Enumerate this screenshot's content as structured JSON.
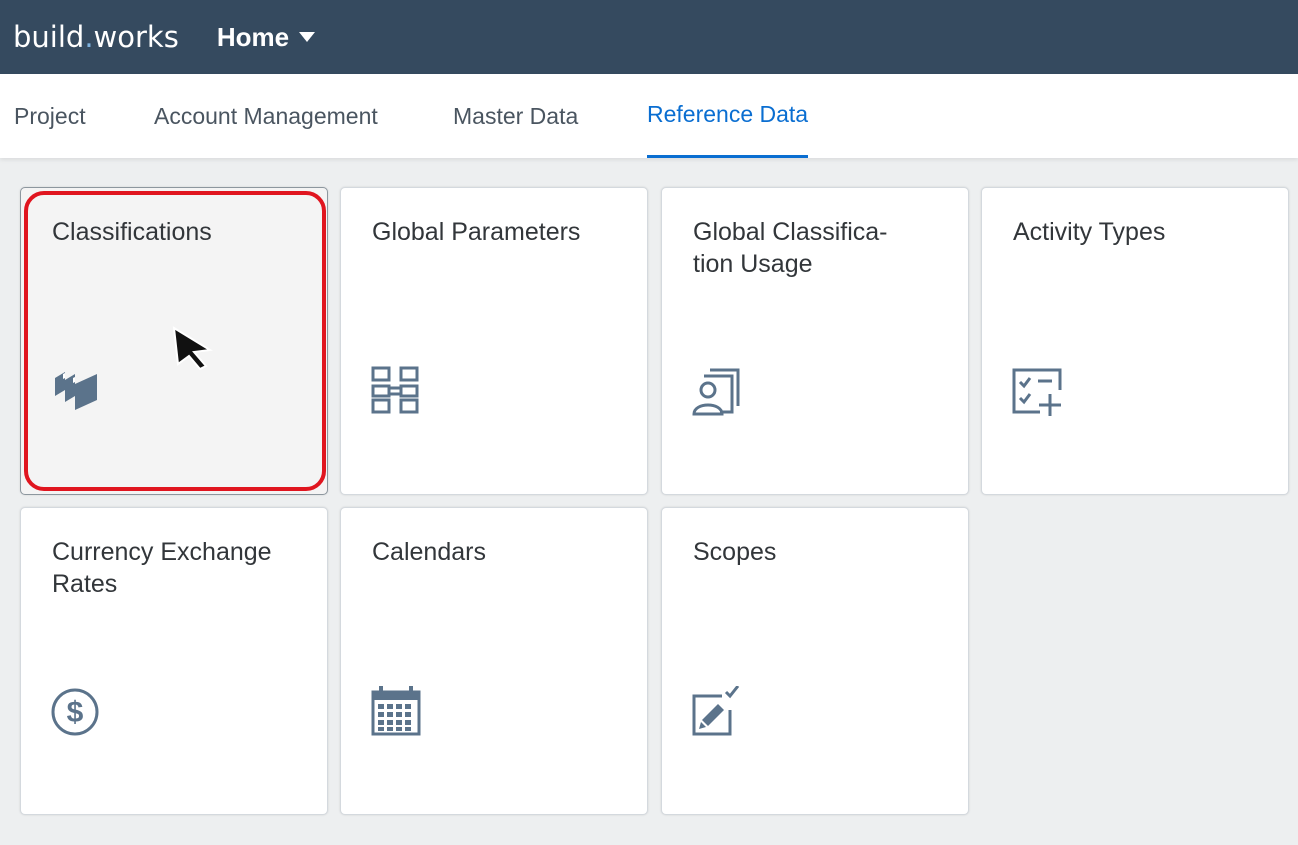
{
  "app": {
    "logo_part1": "build",
    "logo_dot": ".",
    "logo_part2": "works",
    "menu_label": "Home"
  },
  "tabs": [
    {
      "label": "Project",
      "active": false
    },
    {
      "label": "Account Management",
      "active": false
    },
    {
      "label": "Master Data",
      "active": false
    },
    {
      "label": "Reference Data",
      "active": true
    }
  ],
  "tiles": [
    {
      "title": "Classifications",
      "icon": "layers-icon"
    },
    {
      "title": "Global Parameters",
      "icon": "parameters-icon"
    },
    {
      "title": "Global Classifica-\ntion Usage",
      "icon": "user-documents-icon"
    },
    {
      "title": "Activity Types",
      "icon": "checklist-add-icon"
    },
    {
      "title": "Currency Exchange Rates",
      "icon": "dollar-icon"
    },
    {
      "title": "Calendars",
      "icon": "calendar-icon"
    },
    {
      "title": "Scopes",
      "icon": "edit-document-icon"
    }
  ],
  "colors": {
    "shell": "#354a5f",
    "accent": "#0a6ed1",
    "icon": "#5b738b",
    "highlight": "#e0151f"
  }
}
